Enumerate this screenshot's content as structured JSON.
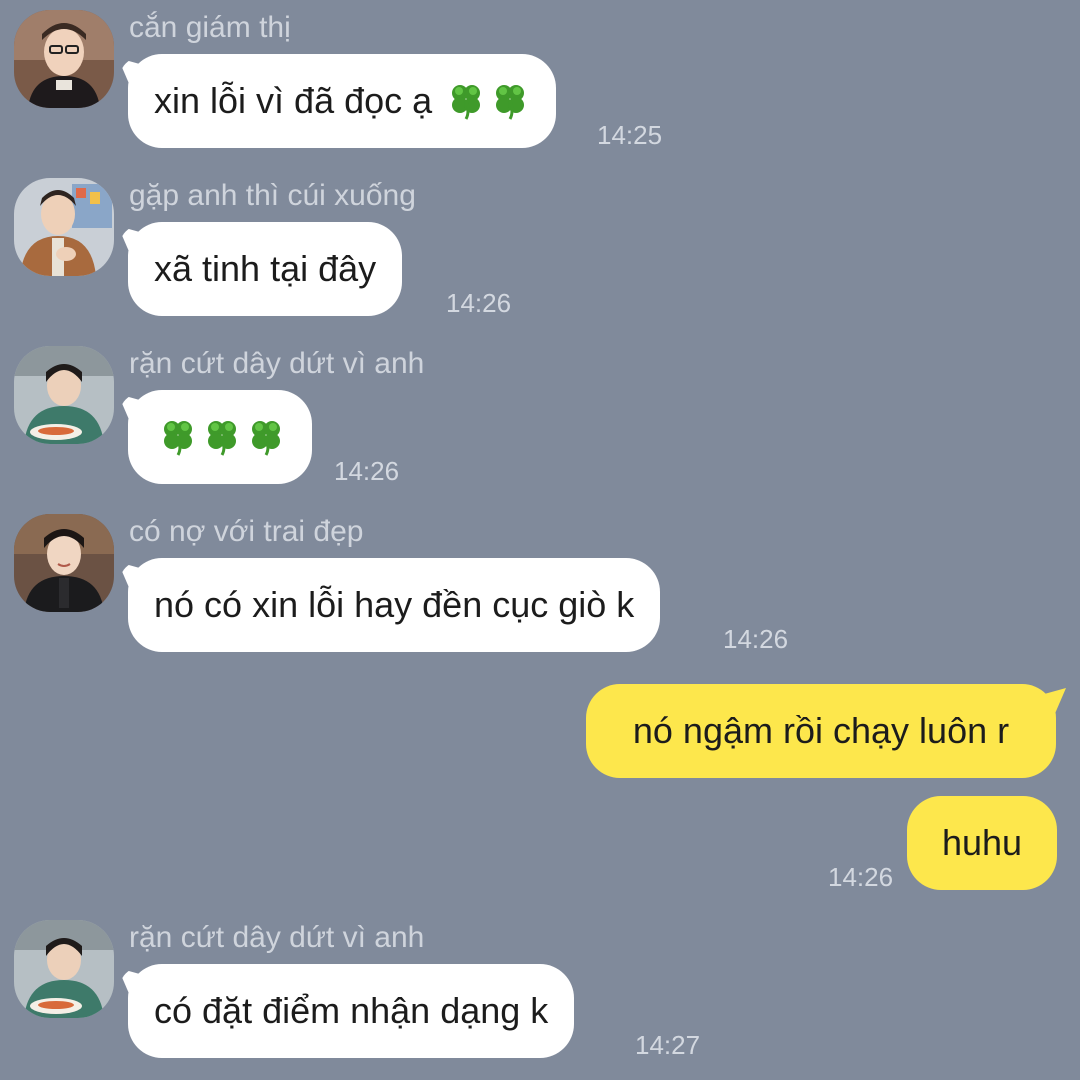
{
  "messages": [
    {
      "sender": "cắn giám thị",
      "text": "xin lỗi vì đã đọc ạ",
      "clovers": 2,
      "time": "14:25",
      "avatar": "avatar-1"
    },
    {
      "sender": "gặp anh thì cúi xuống",
      "text": "xã tinh tại đây",
      "clovers": 0,
      "time": "14:26",
      "avatar": "avatar-2"
    },
    {
      "sender": "rặn cứt dây dứt vì anh",
      "text": "",
      "clovers": 3,
      "time": "14:26",
      "avatar": "avatar-3"
    },
    {
      "sender": "có nợ với trai đẹp",
      "text": "nó có xin lỗi hay đền cục giò k",
      "clovers": 0,
      "time": "14:26",
      "avatar": "avatar-4"
    }
  ],
  "outgoing": [
    {
      "text": "nó ngậm rồi chạy luôn r"
    },
    {
      "text": "huhu",
      "time": "14:26"
    }
  ],
  "last_message": {
    "sender": "rặn cứt dây dứt vì anh",
    "text": "có đặt điểm nhận dạng k",
    "time": "14:27"
  },
  "colors": {
    "background": "#808a9b",
    "incoming_bubble": "#ffffff",
    "outgoing_bubble": "#fde74c"
  },
  "icons": {
    "clover": "four-leaf-clover-emoji"
  }
}
